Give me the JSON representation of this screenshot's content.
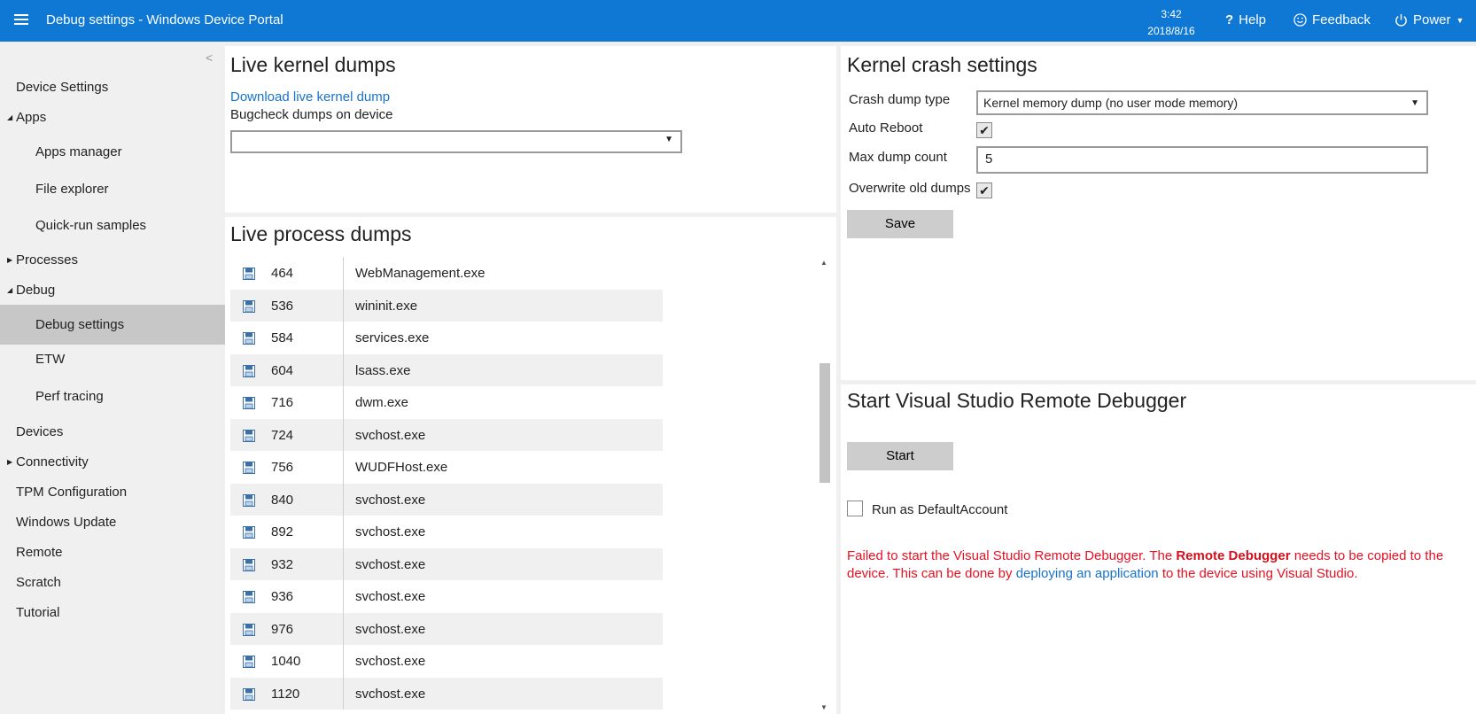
{
  "header": {
    "title": "Debug settings - Windows Device Portal",
    "time": "3:42",
    "date": "2018/8/16",
    "help_label": "Help",
    "feedback_label": "Feedback",
    "power_label": "Power",
    "bg_color": "#0f78d4"
  },
  "sidebar": {
    "items": [
      {
        "label": "Device Settings"
      },
      {
        "label": "Apps"
      },
      {
        "label": "Apps manager"
      },
      {
        "label": "File explorer"
      },
      {
        "label": "Quick-run samples"
      },
      {
        "label": "Processes"
      },
      {
        "label": "Debug"
      },
      {
        "label": "Debug settings"
      },
      {
        "label": "ETW"
      },
      {
        "label": "Perf tracing"
      },
      {
        "label": "Devices"
      },
      {
        "label": "Connectivity"
      },
      {
        "label": "TPM Configuration"
      },
      {
        "label": "Windows Update"
      },
      {
        "label": "Remote"
      },
      {
        "label": "Scratch"
      },
      {
        "label": "Tutorial"
      }
    ]
  },
  "kernel_dumps": {
    "title": "Live kernel dumps",
    "download_link": "Download live kernel dump",
    "bugcheck_label": "Bugcheck dumps on device",
    "bugcheck_value": ""
  },
  "process_dumps": {
    "title": "Live process dumps",
    "rows": [
      {
        "pid": "464",
        "name": "WebManagement.exe"
      },
      {
        "pid": "536",
        "name": "wininit.exe"
      },
      {
        "pid": "584",
        "name": "services.exe"
      },
      {
        "pid": "604",
        "name": "lsass.exe"
      },
      {
        "pid": "716",
        "name": "dwm.exe"
      },
      {
        "pid": "724",
        "name": "svchost.exe"
      },
      {
        "pid": "756",
        "name": "WUDFHost.exe"
      },
      {
        "pid": "840",
        "name": "svchost.exe"
      },
      {
        "pid": "892",
        "name": "svchost.exe"
      },
      {
        "pid": "932",
        "name": "svchost.exe"
      },
      {
        "pid": "936",
        "name": "svchost.exe"
      },
      {
        "pid": "976",
        "name": "svchost.exe"
      },
      {
        "pid": "1040",
        "name": "svchost.exe"
      },
      {
        "pid": "1120",
        "name": "svchost.exe"
      }
    ]
  },
  "crash_settings": {
    "title": "Kernel crash settings",
    "crash_type_label": "Crash dump type",
    "crash_type_value": "Kernel memory dump (no user mode memory)",
    "auto_reboot_label": "Auto Reboot",
    "auto_reboot_checked": true,
    "max_dump_label": "Max dump count",
    "max_dump_value": "5",
    "overwrite_label": "Overwrite old dumps",
    "overwrite_checked": true,
    "save_label": "Save"
  },
  "remote_debugger": {
    "title": "Start Visual Studio Remote Debugger",
    "start_label": "Start",
    "run_as_label": "Run as DefaultAccount",
    "run_as_checked": false,
    "error_part1": "Failed to start the Visual Studio Remote Debugger. The ",
    "error_bold": "Remote Debugger",
    "error_part2": " needs to be copied to the device. This can be done by ",
    "error_link": "deploying an application",
    "error_part3": " to the device using Visual Studio.",
    "error_color": "#e81123"
  }
}
